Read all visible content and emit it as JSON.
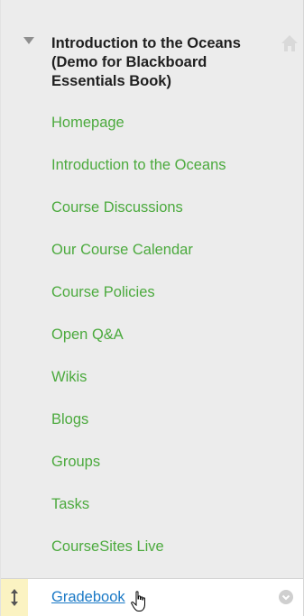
{
  "course": {
    "title": "Introduction to the Oceans (Demo for Blackboard Essentials Book)"
  },
  "menu": {
    "items": [
      {
        "label": "Homepage"
      },
      {
        "label": "Introduction to the Oceans"
      },
      {
        "label": "Course Discussions"
      },
      {
        "label": "Our Course Calendar"
      },
      {
        "label": "Course Policies"
      },
      {
        "label": "Open Q&A"
      },
      {
        "label": "Wikis"
      },
      {
        "label": "Blogs"
      },
      {
        "label": "Groups"
      },
      {
        "label": "Tasks"
      },
      {
        "label": "CourseSites Live"
      }
    ],
    "selected": {
      "label": "Gradebook"
    }
  },
  "icons": {
    "collapse": "triangle-down-icon",
    "home": "home-icon",
    "drag": "drag-handle-icon",
    "cursor": "hand-cursor-icon",
    "options": "chevron-down-icon"
  },
  "colors": {
    "panel_bg": "#ececec",
    "menu_link": "#4caa3e",
    "selected_link": "#1a79c6",
    "drag_handle_bg": "#fbf3c2",
    "title_text": "#1f1f1f"
  }
}
